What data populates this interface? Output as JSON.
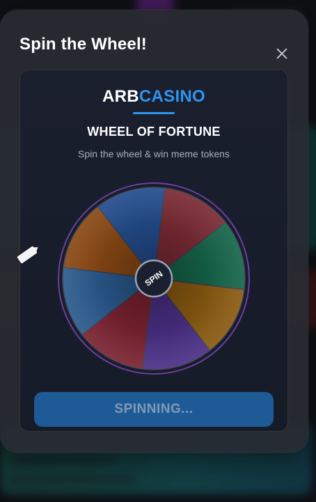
{
  "modal": {
    "title": "Spin the Wheel!",
    "close_icon": "close-icon"
  },
  "brand": {
    "part1": "ARB",
    "part2": "CASINO",
    "accent_color": "#2e95f0"
  },
  "game": {
    "heading": "WHEEL OF FORTUNE",
    "subheading": "Spin the wheel & win meme tokens",
    "hub_label": "SPIN",
    "pointer_icon": "pointer-icon"
  },
  "wheel": {
    "segment_colors": [
      "#7a2a34",
      "#15654a",
      "#8a5a10",
      "#4a2f86",
      "#7a2230",
      "#2a5a8e",
      "#8a4814",
      "#234c8c"
    ],
    "rim_color": "#6b3fa0"
  },
  "action": {
    "button_label": "SPINNING...",
    "button_color": "#1e5a96"
  }
}
